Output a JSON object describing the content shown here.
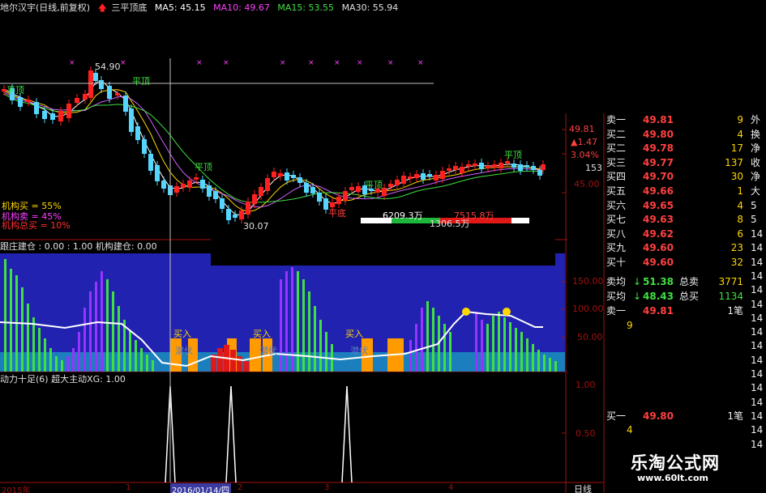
{
  "header": {
    "stock_title": "地尔汉宇(日线,前复权)",
    "arrow_icon": "red-up-arrow-icon",
    "pattern_name": "三平顶底",
    "ma5_label": "MA5: 45.15",
    "ma10_label": "MA10: 49.67",
    "ma15_label": "MA15: 53.55",
    "ma30_label": "MA30: 55.94"
  },
  "price_panel": {
    "high_label": "54.90",
    "low_label": "30.07",
    "flat_top_label": "平顶",
    "flat_bottom_label": "平底",
    "institution_buy": "机构买 = 55%",
    "institution_sell": "机构卖 = 45%",
    "institution_total": "机构总买 = 10%",
    "vol_left": "6209.3万",
    "vol_mid": "1306.5万",
    "vol_right": "7515.8万",
    "axis_labels": [
      "49.81",
      "▲1.47",
      "3.04%",
      "153",
      "45.00"
    ]
  },
  "indicator1": {
    "title": "跟庄建仓 : 0.00 : 1.00 机构建仓: 0.00",
    "buy_label": "买入",
    "hidden_label": "潜伏",
    "axis_labels": [
      "150.00",
      "100.00",
      "50.00"
    ]
  },
  "indicator2": {
    "title": "动力十足(6)  超大主动XG: 1.00",
    "axis_labels": [
      "1.00",
      "0.50"
    ]
  },
  "time_axis": {
    "labels": [
      "2015年",
      "1",
      "2016/01/14/四",
      "2",
      "3",
      "4"
    ],
    "period": "日线"
  },
  "order_book": {
    "sells": [
      {
        "label": "卖一",
        "price": "49.81",
        "vol": "9"
      },
      {
        "label": "买二",
        "price": "49.80",
        "vol": "4"
      },
      {
        "label": "买二",
        "price": "49.78",
        "vol": "17"
      },
      {
        "label": "买三",
        "price": "49.77",
        "vol": "137"
      },
      {
        "label": "买四",
        "price": "49.70",
        "vol": "30"
      },
      {
        "label": "买五",
        "price": "49.66",
        "vol": "1"
      },
      {
        "label": "买六",
        "price": "49.65",
        "vol": "4"
      },
      {
        "label": "买七",
        "price": "49.63",
        "vol": "8"
      },
      {
        "label": "买八",
        "price": "49.62",
        "vol": "6"
      },
      {
        "label": "买九",
        "price": "49.60",
        "vol": "23"
      },
      {
        "label": "买十",
        "price": "49.60",
        "vol": "32"
      }
    ],
    "avg": [
      {
        "label": "卖均",
        "price": "51.38",
        "sub": "总卖",
        "vol": "3771"
      },
      {
        "label": "买均",
        "price": "48.43",
        "sub": "总买",
        "vol": "1134"
      }
    ],
    "sell1_detail": {
      "label": "卖一",
      "price": "49.81",
      "vol": "1笔",
      "count": "9"
    },
    "buy1_detail": {
      "label": "买一",
      "price": "49.80",
      "vol": "1笔",
      "count": "4"
    }
  },
  "right_cut": [
    "外",
    "换",
    "净",
    "收",
    "净",
    "大",
    "5日",
    "5日"
  ],
  "time_col": [
    "14",
    "14",
    "14",
    "14",
    "14",
    "14",
    "14",
    "14",
    "14",
    "14",
    "14",
    "14",
    "14",
    "14",
    "14",
    "14",
    "14",
    "14",
    "14"
  ],
  "watermark": {
    "brand": "乐淘公式网",
    "url": "www.60lt.com"
  },
  "colors": {
    "up": "#ff2020",
    "down": "#54d6ff",
    "ma5": "#ffffff",
    "ma10": "#ffd700",
    "ma15": "#d060ff",
    "ma30": "#40e040",
    "panel_blue": "#2020b0",
    "orange": "#ff9a00"
  }
}
